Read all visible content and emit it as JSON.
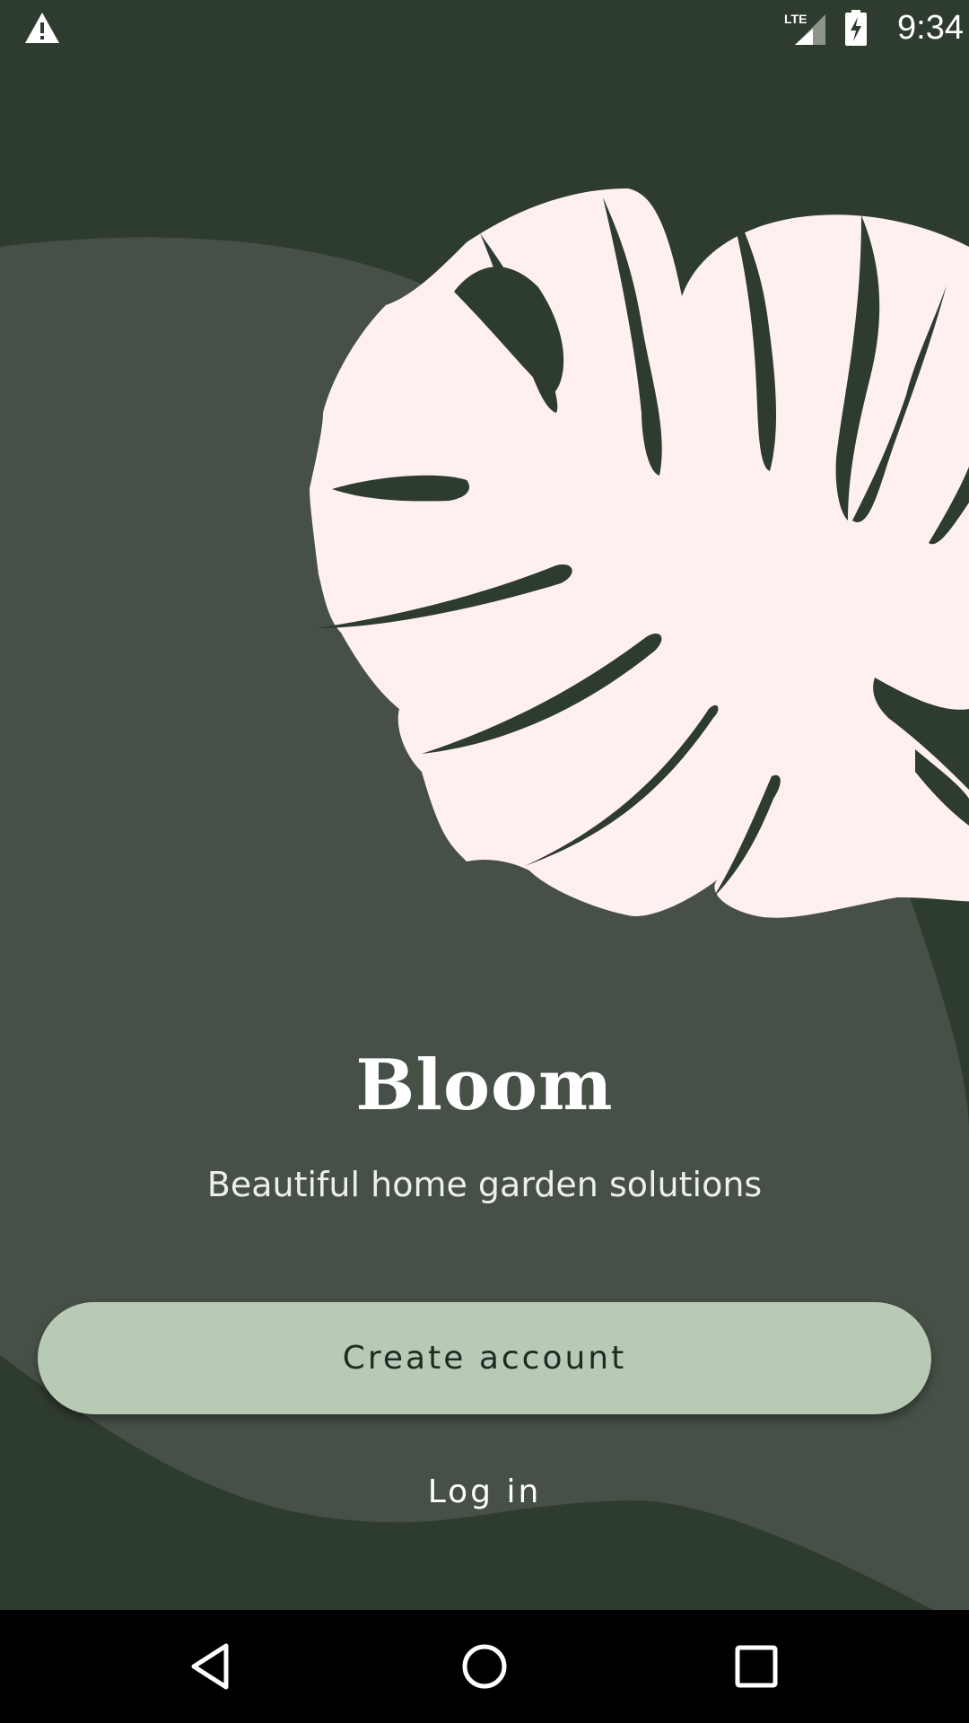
{
  "status_bar": {
    "time": "9:34",
    "network_label": "LTE",
    "icons": [
      "warning-icon",
      "lte-signal-icon",
      "battery-charging-icon"
    ]
  },
  "app": {
    "title": "Bloom",
    "tagline": "Beautiful home garden solutions"
  },
  "actions": {
    "create_account": "Create account",
    "log_in": "Log in"
  },
  "navigation": {
    "icons": [
      "back-icon",
      "home-icon",
      "recents-icon"
    ]
  },
  "colors": {
    "background_dark": "#2e3b2f",
    "background_mid": "#465046",
    "leaf": "#fff0f0",
    "button": "#b8cab6",
    "button_text": "#1f2a20",
    "text": "#ffffff"
  }
}
